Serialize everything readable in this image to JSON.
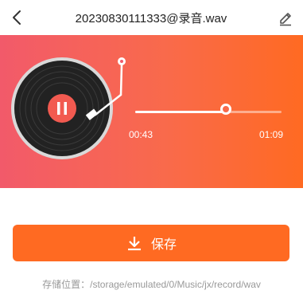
{
  "header": {
    "title": "20230830111333@录音.wav",
    "back_icon": "chevron-left-icon",
    "edit_icon": "pencil-icon"
  },
  "player": {
    "current_time": "00:43",
    "total_time": "01:09",
    "progress_fraction": 0.62,
    "state": "playing",
    "colors": {
      "gradient_start": "#f25a6a",
      "gradient_end": "#ff6a22",
      "accent": "#ff6a22"
    }
  },
  "save": {
    "label": "保存",
    "icon": "download-icon"
  },
  "storage": {
    "text": "存储位置：/storage/emulated/0/Music/jx/record/wav"
  }
}
